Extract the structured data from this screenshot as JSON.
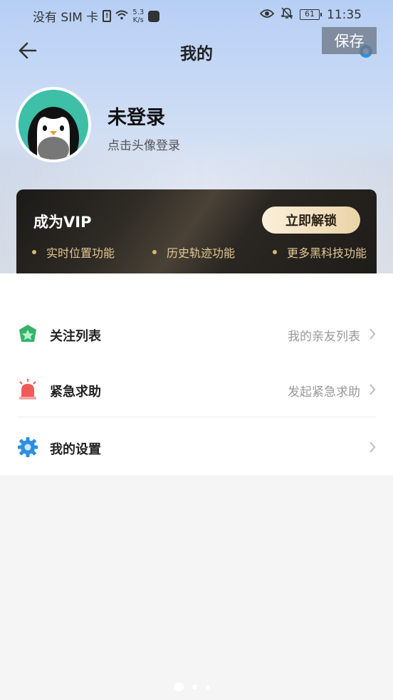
{
  "status_bar": {
    "carrier": "没有 SIM 卡",
    "sim_glyph": "!",
    "speed_value": "5.3",
    "speed_unit": "K/s",
    "battery": "61",
    "time": "11:35"
  },
  "header": {
    "title": "我的",
    "save_label": "保存"
  },
  "profile": {
    "name": "未登录",
    "hint": "点击头像登录"
  },
  "vip": {
    "title": "成为VIP",
    "button": "立即解锁",
    "features": [
      "实时位置功能",
      "历史轨迹功能",
      "更多黑科技功能"
    ]
  },
  "menu": {
    "items": [
      {
        "label": "关注列表",
        "desc": "我的亲友列表",
        "icon": "star-shield-icon"
      },
      {
        "label": "紧急求助",
        "desc": "发起紧急求助",
        "icon": "alarm-siren-icon"
      },
      {
        "label": "我的设置",
        "desc": "",
        "icon": "gear-icon"
      }
    ]
  },
  "colors": {
    "vip_gold": "#e3c790",
    "accent_blue": "#2e8fe0",
    "accent_green": "#35b36a",
    "alarm_red": "#ef5a5a"
  }
}
